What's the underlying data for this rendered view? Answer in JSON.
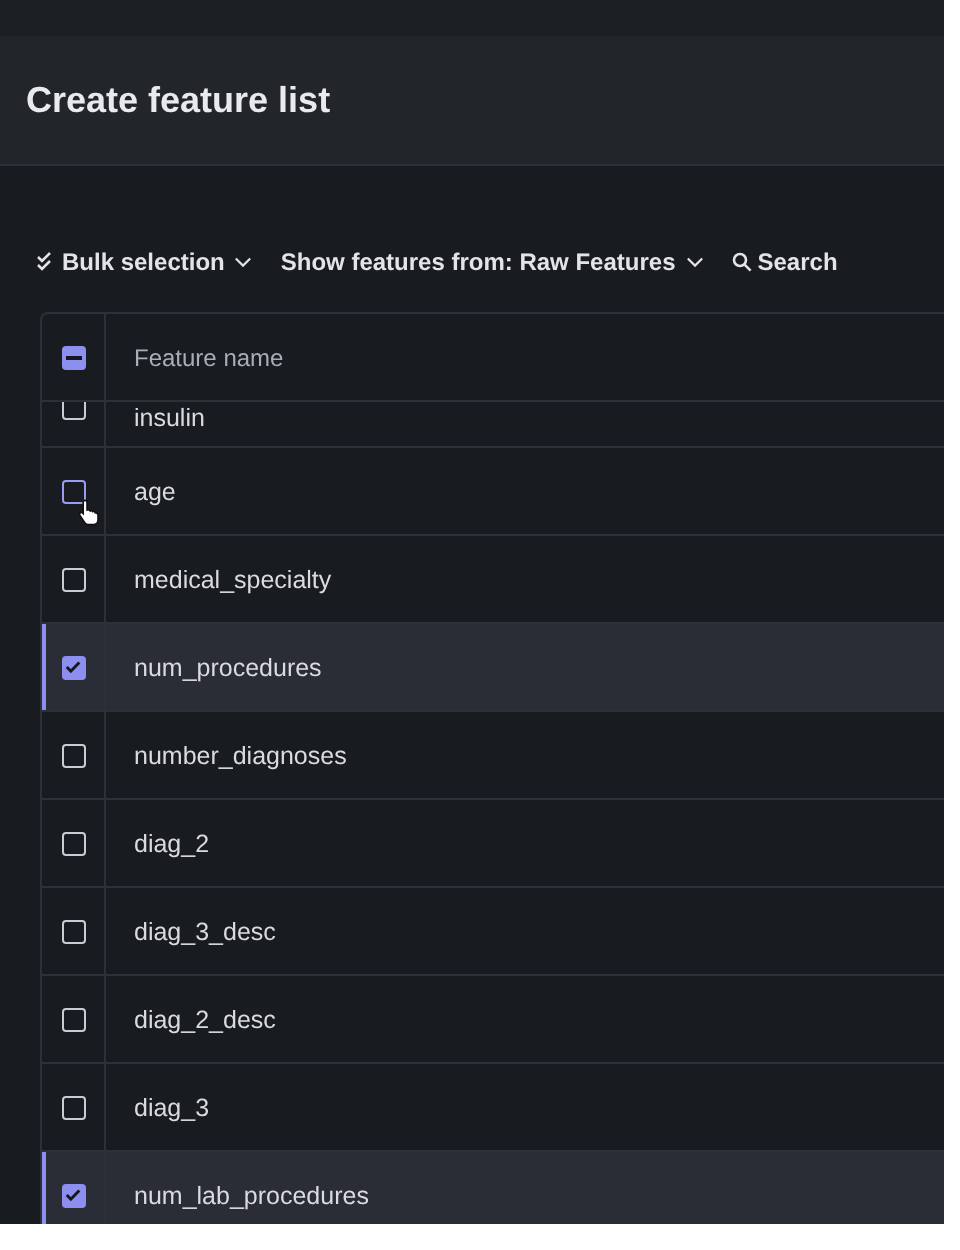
{
  "header": {
    "title": "Create feature list"
  },
  "toolbar": [
    {
      "kind": "bulk",
      "label": "Bulk selection"
    },
    {
      "kind": "filter",
      "label": "Show features from: Raw Features"
    },
    {
      "kind": "search",
      "label": "Search"
    }
  ],
  "table": {
    "select_all": {
      "indeterminate": true
    },
    "columns": [
      "Feature name"
    ],
    "rows": [
      {
        "name": "insulin",
        "selected": false,
        "hovered": false
      },
      {
        "name": "age",
        "selected": false,
        "hovered": true
      },
      {
        "name": "medical_specialty",
        "selected": false,
        "hovered": false
      },
      {
        "name": "num_procedures",
        "selected": true,
        "hovered": false
      },
      {
        "name": "number_diagnoses",
        "selected": false,
        "hovered": false
      },
      {
        "name": "diag_2",
        "selected": false,
        "hovered": false
      },
      {
        "name": "diag_3_desc",
        "selected": false,
        "hovered": false
      },
      {
        "name": "diag_2_desc",
        "selected": false,
        "hovered": false
      },
      {
        "name": "diag_3",
        "selected": false,
        "hovered": false
      },
      {
        "name": "num_lab_procedures",
        "selected": true,
        "hovered": false
      }
    ]
  }
}
